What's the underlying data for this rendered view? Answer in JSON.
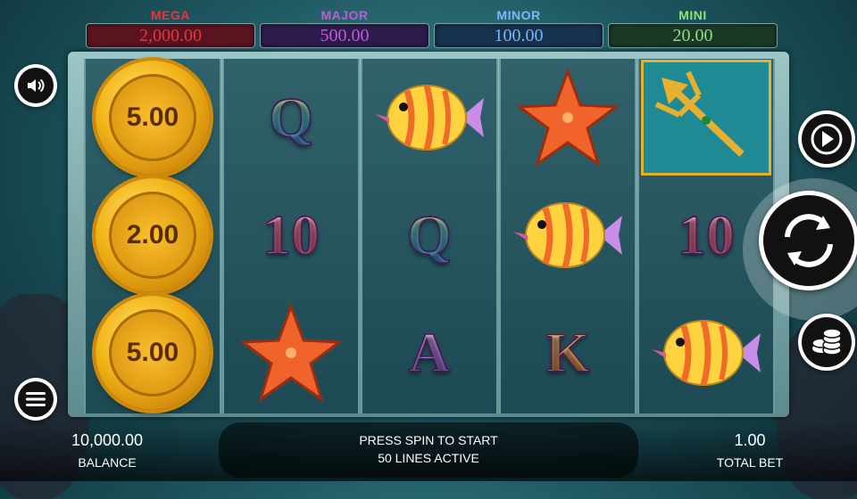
{
  "jackpots": [
    {
      "label": "MEGA",
      "value": "2,000.00",
      "label_color": "#e8343a",
      "bg": "#5a1420"
    },
    {
      "label": "MAJOR",
      "value": "500.00",
      "label_color": "#c15ad8",
      "bg": "#2e1b4e"
    },
    {
      "label": "MINOR",
      "value": "100.00",
      "label_color": "#7bb7ff",
      "bg": "#17324f"
    },
    {
      "label": "MINI",
      "value": "20.00",
      "label_color": "#8ee07c",
      "bg": "#1b3a26"
    }
  ],
  "reels": [
    [
      {
        "type": "coin",
        "value": "5.00"
      },
      {
        "type": "coin",
        "value": "2.00"
      },
      {
        "type": "coin",
        "value": "5.00"
      }
    ],
    [
      {
        "type": "letter",
        "text": "Q"
      },
      {
        "type": "letter",
        "text": "10"
      },
      {
        "type": "starfish"
      }
    ],
    [
      {
        "type": "fish"
      },
      {
        "type": "letter",
        "text": "Q"
      },
      {
        "type": "letter",
        "text": "A"
      }
    ],
    [
      {
        "type": "starfish"
      },
      {
        "type": "fish"
      },
      {
        "type": "letter",
        "text": "K"
      }
    ],
    [
      {
        "type": "trident"
      },
      {
        "type": "letter",
        "text": "10"
      },
      {
        "type": "fish"
      }
    ]
  ],
  "status": {
    "line1": "PRESS SPIN TO START",
    "line2": "50 LINES ACTIVE"
  },
  "balance": {
    "value": "10,000.00",
    "label": "BALANCE"
  },
  "bet": {
    "value": "1.00",
    "label": "TOTAL BET"
  },
  "icons": {
    "sound": "speaker-icon",
    "menu": "hamburger-icon",
    "autoplay": "play-icon",
    "spin": "spin-arrows-icon",
    "bet": "coin-stack-icon"
  },
  "colors": {
    "accent": "#ffffff",
    "coin": "#f2b317"
  }
}
